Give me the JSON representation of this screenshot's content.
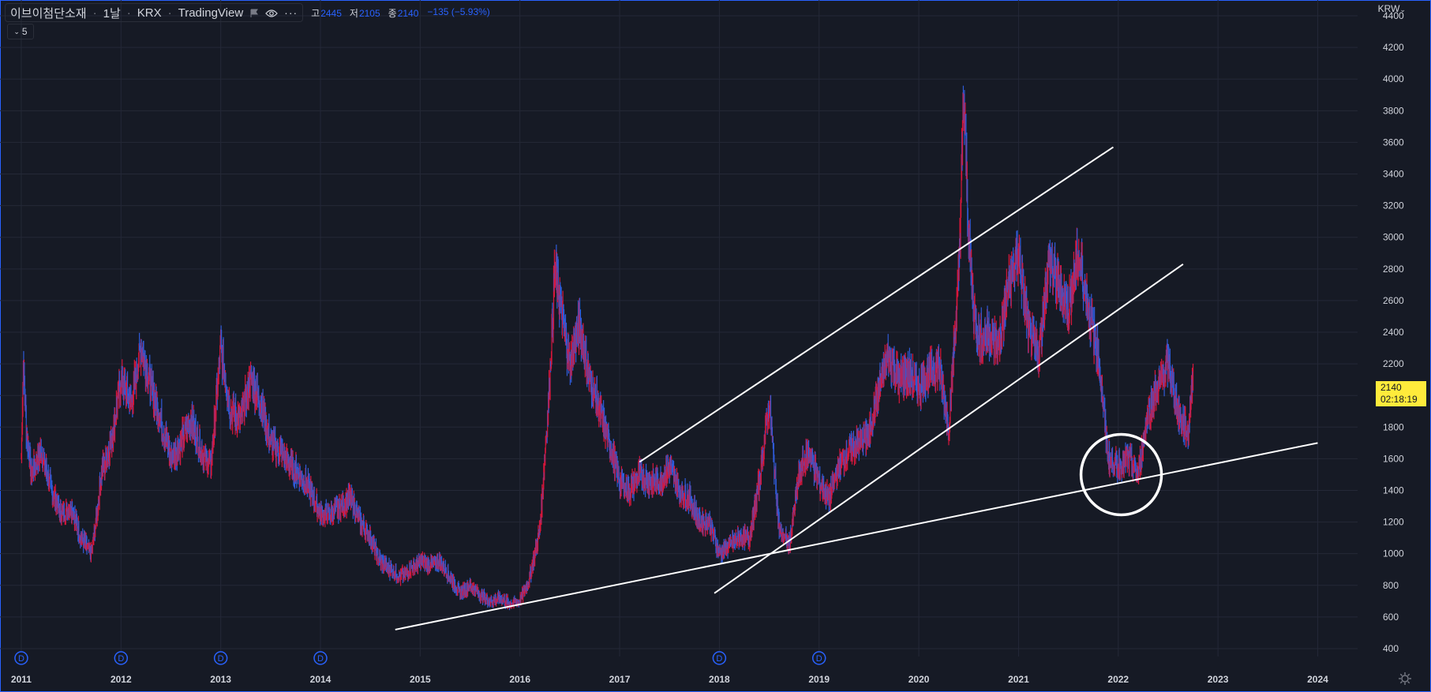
{
  "header": {
    "symbol": "이브이첨단소재",
    "interval": "1날",
    "exchange": "KRX",
    "source": "TradingView",
    "ohlc": {
      "high_label": "고",
      "high": "2445",
      "low_label": "저",
      "low": "2105",
      "close_label": "종",
      "close": "2140",
      "change": "−135 (−5.93%)"
    },
    "indicator_count": "5",
    "currency": "KRW"
  },
  "last_price": {
    "price": "2140",
    "countdown": "02:18:19"
  },
  "colors": {
    "background": "#161a25",
    "grid": "#242837",
    "up": "#d9163b",
    "down": "#2f5bd8",
    "trendline": "#ffffff",
    "price_tag": "#ffeb3b",
    "dividend_marker": "#2962ff"
  },
  "icons": [
    "eye-icon",
    "more-icon",
    "flag-icon",
    "chevron-down-icon",
    "gear-icon",
    "dividend-icon"
  ],
  "dividend_marker_label": "D",
  "chart_data": {
    "type": "line",
    "subtype": "candlestick-approximation",
    "x_unit": "year",
    "y_unit": "KRW",
    "ylim": [
      350,
      4500
    ],
    "xlim": [
      2010.85,
      2024.4
    ],
    "y_ticks": [
      400,
      600,
      800,
      1000,
      1200,
      1400,
      1600,
      1800,
      2000,
      2200,
      2400,
      2600,
      2800,
      3000,
      3200,
      3400,
      3600,
      3800,
      4000,
      4200,
      4400
    ],
    "x_ticks": [
      "2011",
      "2012",
      "2013",
      "2014",
      "2015",
      "2016",
      "2017",
      "2018",
      "2019",
      "2020",
      "2021",
      "2022",
      "2023",
      "2024"
    ],
    "grid": true,
    "series": [
      {
        "x": [
          2011.0,
          2011.02,
          2011.05,
          2011.1,
          2011.2,
          2011.3,
          2011.4,
          2011.5,
          2011.6,
          2011.7,
          2011.75,
          2011.8,
          2011.9,
          2012.0,
          2012.1,
          2012.2,
          2012.3,
          2012.4,
          2012.5,
          2012.6,
          2012.7,
          2012.8,
          2012.9,
          2013.0,
          2013.1,
          2013.2,
          2013.3,
          2013.4,
          2013.5,
          2013.6,
          2013.7,
          2013.8,
          2013.9,
          2014.0,
          2014.1,
          2014.2,
          2014.3,
          2014.4,
          2014.5,
          2014.6,
          2014.7,
          2014.8,
          2014.9,
          2015.0,
          2015.1,
          2015.2,
          2015.3,
          2015.4,
          2015.5,
          2015.6,
          2015.7,
          2015.8,
          2015.9,
          2016.0,
          2016.1,
          2016.2,
          2016.3,
          2016.35,
          2016.4,
          2016.5,
          2016.6,
          2016.7,
          2016.8,
          2016.9,
          2017.0,
          2017.1,
          2017.2,
          2017.3,
          2017.4,
          2017.5,
          2017.6,
          2017.7,
          2017.8,
          2017.9,
          2018.0,
          2018.1,
          2018.2,
          2018.3,
          2018.4,
          2018.5,
          2018.6,
          2018.7,
          2018.8,
          2018.9,
          2019.0,
          2019.1,
          2019.2,
          2019.3,
          2019.4,
          2019.5,
          2019.6,
          2019.7,
          2019.8,
          2019.9,
          2020.0,
          2020.1,
          2020.2,
          2020.3,
          2020.4,
          2020.45,
          2020.5,
          2020.55,
          2020.6,
          2020.7,
          2020.8,
          2020.9,
          2021.0,
          2021.1,
          2021.2,
          2021.3,
          2021.4,
          2021.5,
          2021.6,
          2021.7,
          2021.8,
          2021.9,
          2022.0,
          2022.1,
          2022.2,
          2022.3,
          2022.4,
          2022.5,
          2022.6,
          2022.7,
          2022.75
        ],
        "close": [
          1600,
          2200,
          1800,
          1500,
          1650,
          1400,
          1250,
          1300,
          1100,
          1000,
          1200,
          1500,
          1700,
          2100,
          1950,
          2300,
          2050,
          1850,
          1600,
          1700,
          1850,
          1650,
          1550,
          2300,
          1900,
          1850,
          2100,
          1950,
          1700,
          1650,
          1550,
          1500,
          1400,
          1250,
          1250,
          1300,
          1350,
          1200,
          1100,
          950,
          900,
          850,
          900,
          950,
          930,
          950,
          850,
          750,
          800,
          740,
          700,
          720,
          680,
          700,
          850,
          1150,
          2100,
          2800,
          2600,
          2200,
          2450,
          2100,
          1900,
          1700,
          1450,
          1400,
          1500,
          1450,
          1450,
          1550,
          1400,
          1350,
          1200,
          1200,
          1000,
          1050,
          1100,
          1100,
          1450,
          1950,
          1150,
          1050,
          1500,
          1650,
          1450,
          1350,
          1550,
          1650,
          1700,
          1750,
          2050,
          2250,
          2100,
          2150,
          2050,
          2150,
          2200,
          1800,
          2750,
          3900,
          3000,
          2550,
          2350,
          2400,
          2300,
          2700,
          2900,
          2400,
          2250,
          2850,
          2700,
          2550,
          2900,
          2550,
          2250,
          1600,
          1550,
          1600,
          1500,
          1900,
          2050,
          2200,
          1900,
          1750,
          2140
        ]
      }
    ],
    "annotations": {
      "trendlines_data": [
        {
          "from": [
            2014.75,
            520
          ],
          "to": [
            2024.0,
            1700
          ]
        },
        {
          "from": [
            2017.2,
            1580
          ],
          "to": [
            2021.95,
            3570
          ]
        },
        {
          "from": [
            2017.95,
            750
          ],
          "to": [
            2022.65,
            2830
          ]
        }
      ],
      "circle_center_data": [
        2022.03,
        1500
      ],
      "dividend_markers_x": [
        2011.0,
        2012.0,
        2013.0,
        2014.0,
        2018.0,
        2019.0
      ]
    }
  }
}
